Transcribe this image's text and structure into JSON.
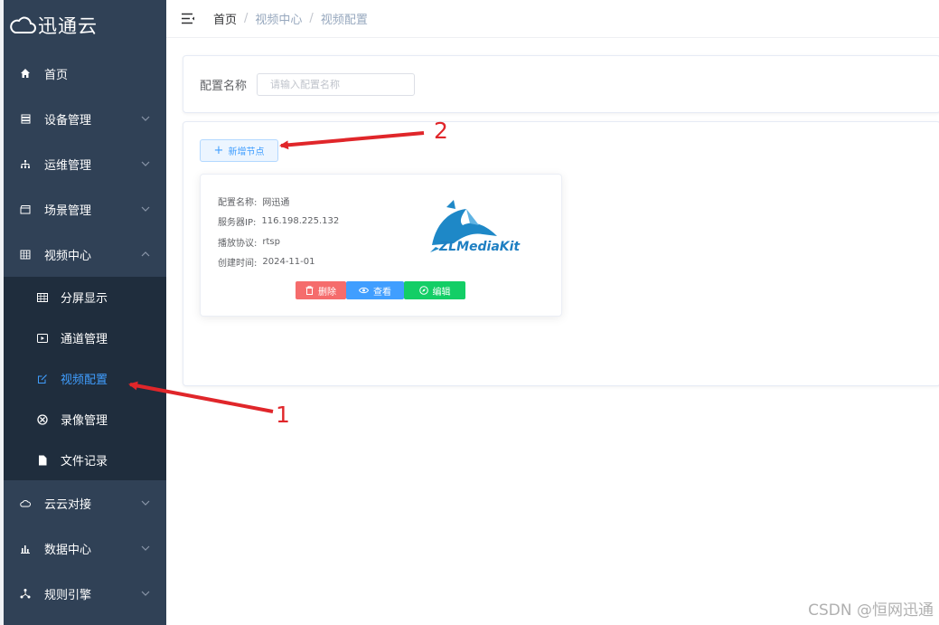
{
  "sidebar": {
    "logo_text": "迅通云",
    "items": [
      {
        "label": "首页"
      },
      {
        "label": "设备管理"
      },
      {
        "label": "运维管理"
      },
      {
        "label": "场景管理"
      },
      {
        "label": "视频中心"
      },
      {
        "label": "云云对接"
      },
      {
        "label": "数据中心"
      },
      {
        "label": "规则引擎"
      }
    ],
    "video_submenu": [
      {
        "label": "分屏显示"
      },
      {
        "label": "通道管理"
      },
      {
        "label": "视频配置"
      },
      {
        "label": "录像管理"
      },
      {
        "label": "文件记录"
      }
    ],
    "active_color": "#409eff"
  },
  "breadcrumb": {
    "items": [
      "首页",
      "视频中心",
      "视频配置"
    ],
    "separator": "/"
  },
  "search": {
    "label": "配置名称",
    "placeholder": "请输入配置名称"
  },
  "toolbar": {
    "add_label": "新增节点"
  },
  "card": {
    "fields": [
      {
        "key": "配置名称:",
        "value": "网迅通"
      },
      {
        "key": "服务器IP:",
        "value": "116.198.225.132"
      },
      {
        "key": "播放协议:",
        "value": "rtsp"
      },
      {
        "key": "创建时间:",
        "value": "2024-11-01"
      }
    ],
    "logo_text": "ZLMediaKit",
    "actions": {
      "delete": "删除",
      "view": "查看",
      "edit": "编辑"
    }
  },
  "annotations": {
    "label_1": "1",
    "label_2": "2"
  },
  "watermark": "CSDN @恒网迅通"
}
